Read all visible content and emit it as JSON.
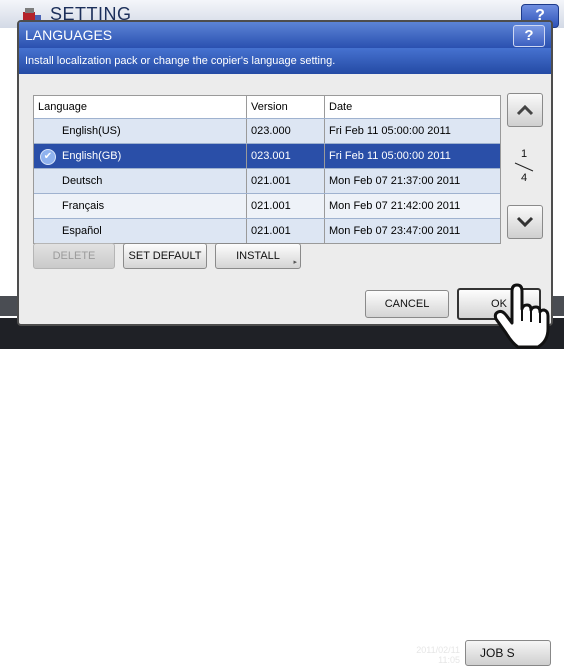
{
  "background": {
    "title": "SETTING",
    "help_label": "?",
    "clock_line1": "2011/02/11",
    "clock_line2": "11:05",
    "job_status_label": "JOB S"
  },
  "dialog": {
    "title": "LANGUAGES",
    "help_label": "?",
    "message": "Install localization pack or change the copier's language setting.",
    "columns": {
      "language": "Language",
      "version": "Version",
      "date": "Date"
    },
    "rows": [
      {
        "language": "English(US)",
        "version": "023.000",
        "date": "Fri Feb 11 05:00:00 2011",
        "selected": false
      },
      {
        "language": "English(GB)",
        "version": "023.001",
        "date": "Fri Feb 11 05:00:00 2011",
        "selected": true
      },
      {
        "language": "Deutsch",
        "version": "021.001",
        "date": "Mon Feb 07 21:37:00 2011",
        "selected": false
      },
      {
        "language": "Français",
        "version": "021.001",
        "date": "Mon Feb 07 21:42:00 2011",
        "selected": false
      },
      {
        "language": "Español",
        "version": "021.001",
        "date": "Mon Feb 07 23:47:00 2011",
        "selected": false
      }
    ],
    "pager": {
      "current": "1",
      "total": "4"
    },
    "buttons": {
      "delete": "DELETE",
      "set_default": "SET DEFAULT",
      "install": "INSTALL",
      "cancel": "CANCEL",
      "ok": "OK"
    }
  },
  "colors": {
    "title_bar": "#2a50b0",
    "selected_row": "#2a4fa8",
    "row_light": "#eef2f8",
    "row_dark": "#dde6f3"
  }
}
